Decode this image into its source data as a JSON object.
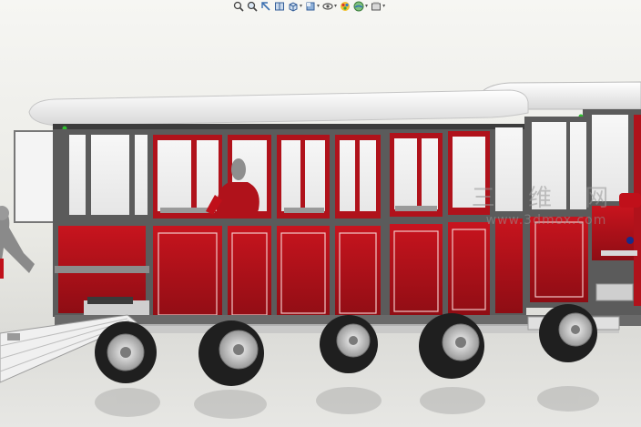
{
  "toolbar": {
    "icons": [
      {
        "name": "zoom-to-fit-icon",
        "has_menu": false
      },
      {
        "name": "zoom-to-area-icon",
        "has_menu": false
      },
      {
        "name": "previous-view-icon",
        "has_menu": false
      },
      {
        "name": "section-view-icon",
        "has_menu": false
      },
      {
        "name": "view-orientation-icon",
        "has_menu": true
      },
      {
        "name": "display-style-icon",
        "has_menu": true
      },
      {
        "name": "hide-show-items-icon",
        "has_menu": true
      },
      {
        "name": "edit-appearance-icon",
        "has_menu": false
      },
      {
        "name": "apply-scene-icon",
        "has_menu": true
      },
      {
        "name": "view-settings-icon",
        "has_menu": true
      }
    ]
  },
  "watermark": {
    "cjk": "三 维 网",
    "url": "www.3dmox.com"
  },
  "colors": {
    "body_red": "#b0121b",
    "roof_white": "#f2f2f2",
    "frame_gray": "#5b5b5b",
    "background": "#ececea"
  }
}
